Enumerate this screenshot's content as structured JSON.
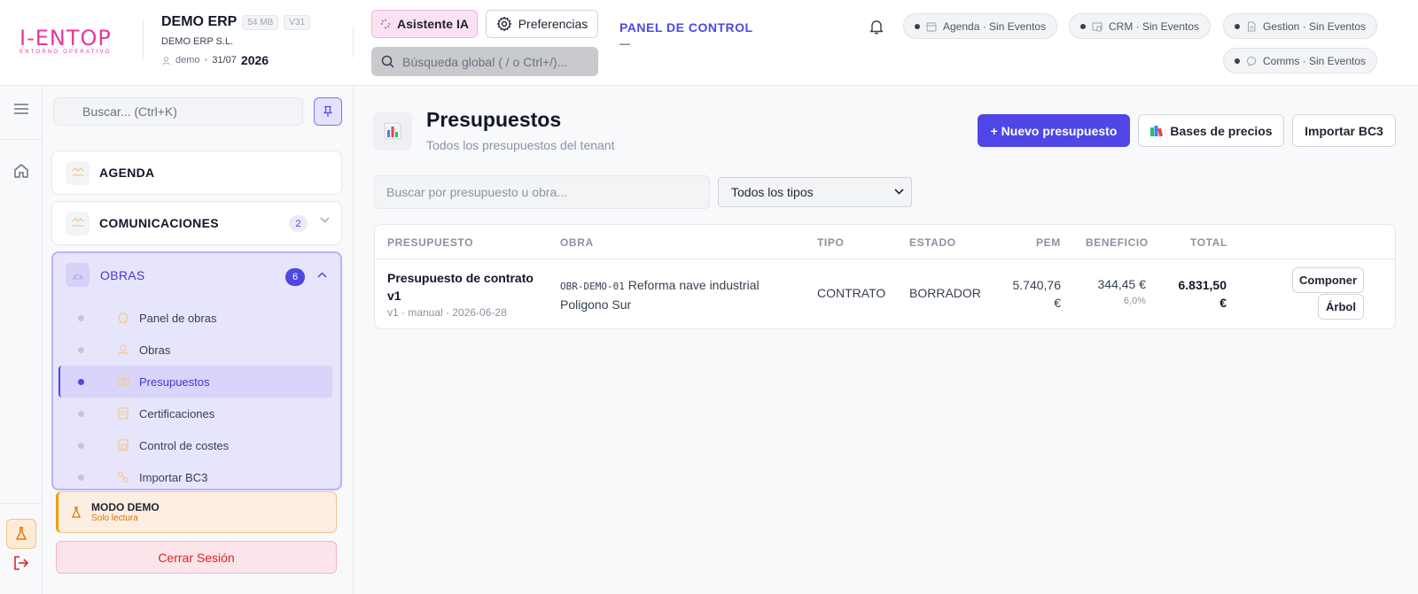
{
  "header": {
    "logo_text": "I-ENTOP",
    "logo_sub": "ENTORNO OPERATIVO",
    "company_name": "DEMO ERP",
    "size_tag": "54 MB",
    "version_tag": "V31",
    "company_legal": "DEMO ERP S.L.",
    "user": "demo",
    "date": "31/07",
    "year": "2026",
    "ai_button": "Asistente IA",
    "prefs_button": "Preferencias",
    "global_search_placeholder": "Búsqueda global ( / o Ctrl+/)...",
    "panel_title": "PANEL DE CONTROL",
    "panel_sub": "—",
    "events": [
      {
        "label": "Agenda · Sin Eventos",
        "icon": "calendar-icon"
      },
      {
        "label": "CRM · Sin Eventos",
        "icon": "crm-icon"
      },
      {
        "label": "Gestion · Sin Eventos",
        "icon": "document-icon"
      },
      {
        "label": "Comms · Sin Eventos",
        "icon": "chat-icon"
      }
    ]
  },
  "sidebar": {
    "search_placeholder": "Buscar... (Ctrl+K)",
    "sections": [
      {
        "label": "AGENDA"
      },
      {
        "label": "COMUNICACIONES",
        "badge": "2"
      },
      {
        "label": "OBRAS",
        "badge": "6"
      }
    ],
    "obras_items": [
      {
        "label": "Panel de obras"
      },
      {
        "label": "Obras"
      },
      {
        "label": "Presupuestos",
        "active": true
      },
      {
        "label": "Certificaciones"
      },
      {
        "label": "Control de costes"
      },
      {
        "label": "Importar BC3"
      }
    ],
    "demo_title": "MODO DEMO",
    "demo_sub": "Solo lectura",
    "logout": "Cerrar Sesión"
  },
  "main": {
    "title": "Presupuestos",
    "subtitle": "Todos los presupuestos del tenant",
    "new_button": "+ Nuevo presupuesto",
    "prices_button": "Bases de precios",
    "import_button": "Importar BC3",
    "filter_placeholder": "Buscar por presupuesto u obra...",
    "filter_select": "Todos los tipos",
    "columns": [
      "PRESUPUESTO",
      "OBRA",
      "TIPO",
      "ESTADO",
      "PEM",
      "BENEFICIO",
      "TOTAL"
    ],
    "rows": [
      {
        "name_line1": "Presupuesto de contrato",
        "name_line2": "v1",
        "meta": "v1 · manual · 2026-06-28",
        "obra_code": "OBR-DEMO-01",
        "obra_line1": "Reforma nave industrial",
        "obra_line2": "Poligono Sur",
        "tipo": "CONTRATO",
        "estado": "BORRADOR",
        "pem_line1": "5.740,76",
        "pem_line2": "€",
        "beneficio": "344,45 €",
        "beneficio_pct": "6,0%",
        "total_line1": "6.831,50",
        "total_line2": "€",
        "action1": "Componer",
        "action2": "Árbol"
      }
    ]
  },
  "colors": {
    "accent": "#4f46e5",
    "brand": "#e6379f",
    "danger": "#dc2626",
    "warning": "#f59e0b"
  }
}
